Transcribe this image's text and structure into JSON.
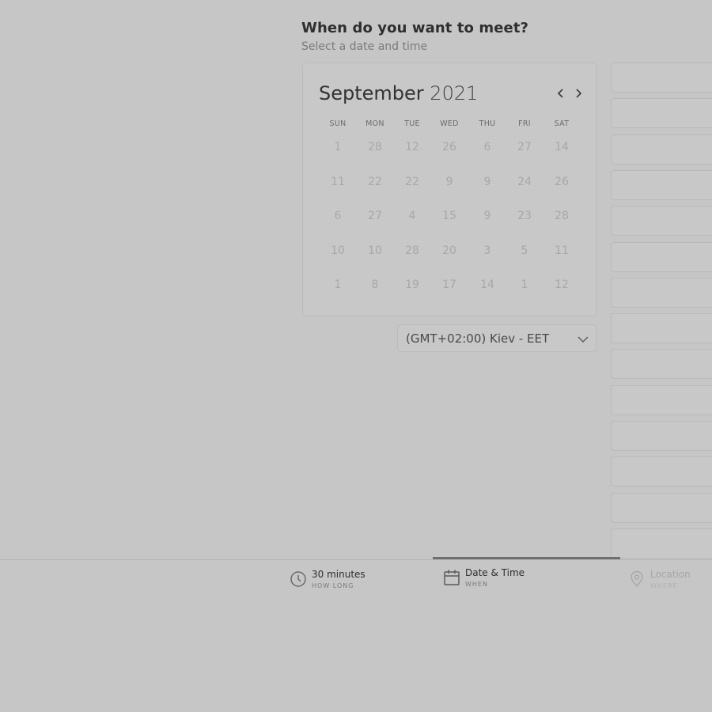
{
  "header": {
    "title": "When do you want to meet?",
    "subtitle": "Select a date and time"
  },
  "calendar": {
    "month": "September",
    "year": "2021",
    "prev_icon": "chevron-left-icon",
    "next_icon": "chevron-right-icon",
    "weekdays": [
      "SUN",
      "MON",
      "TUE",
      "WED",
      "THU",
      "FRI",
      "SAT"
    ],
    "weeks": [
      [
        "1",
        "28",
        "12",
        "26",
        "6",
        "27",
        "14"
      ],
      [
        "11",
        "22",
        "22",
        "9",
        "9",
        "24",
        "26"
      ],
      [
        "6",
        "27",
        "4",
        "15",
        "9",
        "23",
        "28"
      ],
      [
        "10",
        "10",
        "28",
        "20",
        "3",
        "5",
        "11"
      ],
      [
        "1",
        "8",
        "19",
        "17",
        "14",
        "1",
        "12"
      ]
    ]
  },
  "timezone": {
    "selected": "(GMT+02:00) Kiev - EET",
    "icon": "chevron-down-icon"
  },
  "time_slots": {
    "count_visible": 14
  },
  "steps": [
    {
      "title": "30 minutes",
      "subtitle": "HOW LONG",
      "icon": "clock-icon",
      "state": "done"
    },
    {
      "title": "Date & Time",
      "subtitle": "WHEN",
      "icon": "calendar-icon",
      "state": "active"
    },
    {
      "title": "Location",
      "subtitle": "WHERE",
      "icon": "map-pin-icon",
      "state": "upcoming"
    }
  ],
  "colors": {
    "background": "#c6c6c6",
    "active_step_bar": "#6f6f6f",
    "disabled_day": "#a8a8a8"
  }
}
